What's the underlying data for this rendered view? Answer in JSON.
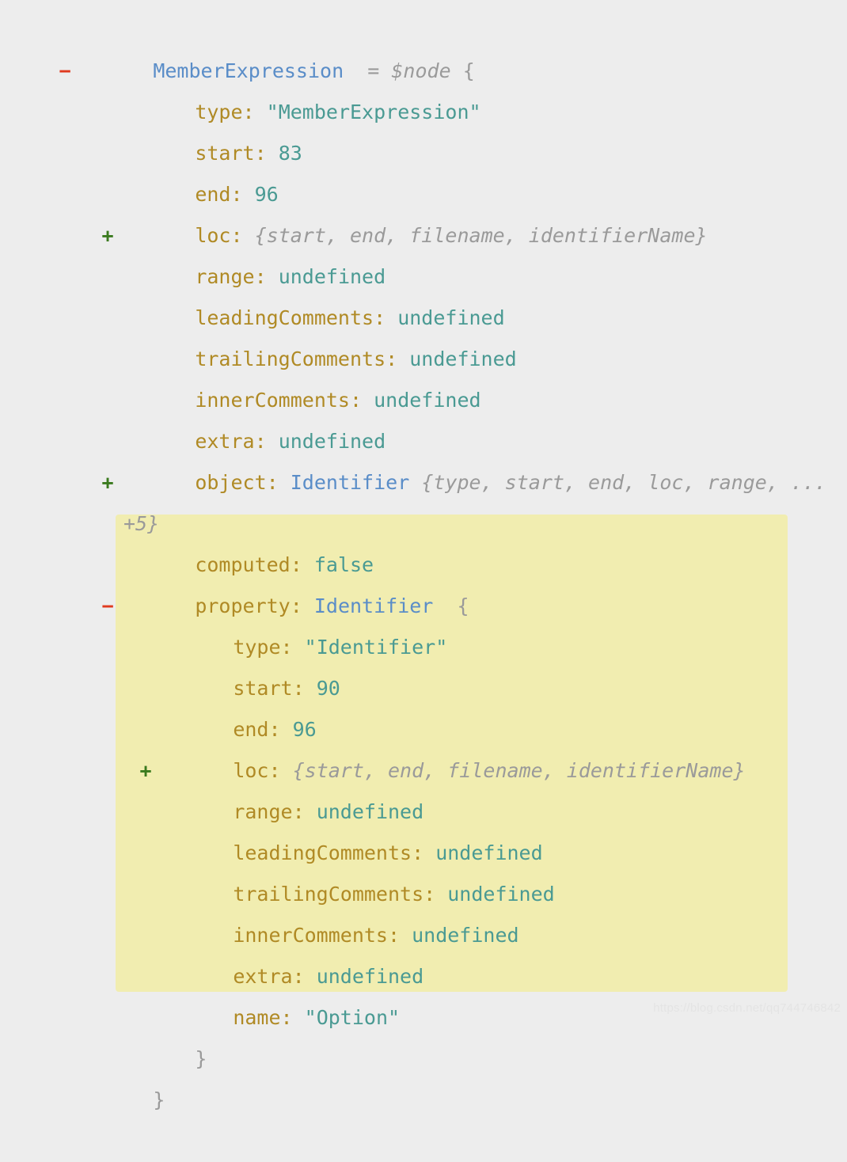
{
  "theme": {
    "background": "#ededed",
    "highlight_background": "#f1edb0",
    "key_color": "#b08a25",
    "value_color": "#4a9a93",
    "type_color": "#5a8dc8",
    "dim_color": "#9a9a9a",
    "punct_color": "#a8a8a8",
    "expander_collapse_color": "#e03a1e",
    "expander_expand_color": "#3a7a1e"
  },
  "root": {
    "marker": "−",
    "name": "MemberExpression",
    "assign": "=",
    "variable": "$node",
    "open_brace": "{",
    "close_brace": "}"
  },
  "properties": {
    "type": {
      "key": "type:",
      "value": "\"MemberExpression\""
    },
    "start": {
      "key": "start:",
      "value": "83"
    },
    "end": {
      "key": "end:",
      "value": "96"
    },
    "loc": {
      "marker": "+",
      "key": "loc:",
      "preview": "{start, end, filename, identifierName}"
    },
    "range": {
      "key": "range:",
      "value": "undefined"
    },
    "leadingComments": {
      "key": "leadingComments:",
      "value": "undefined"
    },
    "trailingComments": {
      "key": "trailingComments:",
      "value": "undefined"
    },
    "innerComments": {
      "key": "innerComments:",
      "value": "undefined"
    },
    "extra": {
      "key": "extra:",
      "value": "undefined"
    },
    "object": {
      "marker": "+",
      "key": "object:",
      "type": "Identifier",
      "preview": "{type, start, end, loc, range, ... +5}"
    },
    "computed": {
      "key": "computed:",
      "value": "false"
    }
  },
  "property_node": {
    "marker": "−",
    "key": "property:",
    "type": "Identifier",
    "open_brace": "{",
    "close_brace": "}",
    "highlighted": true,
    "children": {
      "type": {
        "key": "type:",
        "value": "\"Identifier\""
      },
      "start": {
        "key": "start:",
        "value": "90"
      },
      "end": {
        "key": "end:",
        "value": "96"
      },
      "loc": {
        "marker": "+",
        "key": "loc:",
        "preview": "{start, end, filename, identifierName}"
      },
      "range": {
        "key": "range:",
        "value": "undefined"
      },
      "leadingComments": {
        "key": "leadingComments:",
        "value": "undefined"
      },
      "trailingComments": {
        "key": "trailingComments:",
        "value": "undefined"
      },
      "innerComments": {
        "key": "innerComments:",
        "value": "undefined"
      },
      "extra": {
        "key": "extra:",
        "value": "undefined"
      },
      "name": {
        "key": "name:",
        "value": "\"Option\""
      }
    }
  },
  "watermark": {
    "text": "https://blog.csdn.net/qq744746842"
  }
}
